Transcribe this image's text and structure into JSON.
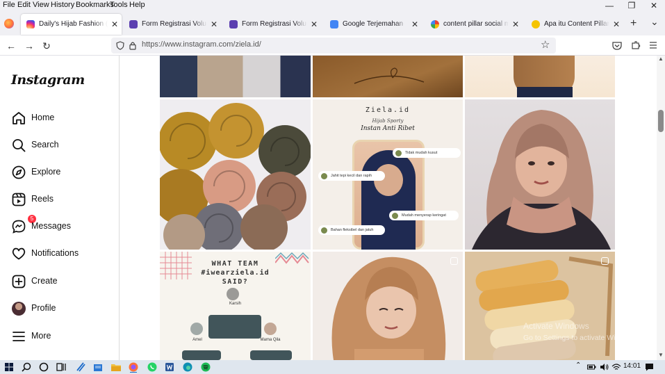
{
  "menubar": {
    "items": [
      "File",
      "Edit",
      "View",
      "History",
      "Bookmarks",
      "Tools",
      "Help"
    ],
    "minimize": "—",
    "restore": "❐",
    "close": "✕"
  },
  "tabs": [
    {
      "label": "Daily's Hijab Fashion (@ziela.id)",
      "favicon_color": "#d62976"
    },
    {
      "label": "Form Registrasi Volunteer Jalan",
      "favicon_color": "#5b3fb0"
    },
    {
      "label": "Form Registrasi Volunteer Jalan",
      "favicon_color": "#5b3fb0"
    },
    {
      "label": "Google Terjemahan",
      "favicon_color": "#4285f4"
    },
    {
      "label": "content pillar social media - Google",
      "favicon_color": "#ea4335"
    },
    {
      "label": "Apa itu Content Pillar? Pengertian",
      "favicon_color": "#f5c400"
    }
  ],
  "tab_close": "✕",
  "new_tab": "+",
  "tab_list": "⌄",
  "navbar": {
    "back": "←",
    "forward": "→",
    "reload": "↻",
    "url": "https://www.instagram.com/ziela.id/",
    "bookmark": "☆"
  },
  "instagram": {
    "logo": "Instagram",
    "nav": [
      {
        "label": "Home",
        "icon": "home-icon"
      },
      {
        "label": "Search",
        "icon": "search-icon"
      },
      {
        "label": "Explore",
        "icon": "explore-icon"
      },
      {
        "label": "Reels",
        "icon": "reels-icon"
      },
      {
        "label": "Messages",
        "icon": "messages-icon",
        "badge": "5"
      },
      {
        "label": "Notifications",
        "icon": "heart-icon"
      },
      {
        "label": "Create",
        "icon": "create-icon"
      },
      {
        "label": "Profile",
        "icon": "profile-avatar"
      },
      {
        "label": "More",
        "icon": "menu-icon"
      }
    ]
  },
  "posts": {
    "ad_brand": "Ziela.id",
    "ad_subtitle": "Hijab Sporty",
    "ad_title": "Instan Anti Ribet",
    "ad_bullets": [
      "Tidak mudah kusut",
      "Jahit tepi kecil dan rapih",
      "Mudah menyerap keringat",
      "Bahan fleksibel dan jatuh"
    ],
    "team_title_1": "WHAT TEAM",
    "team_title_2": "#iwearziela.id",
    "team_title_3": "SAID?",
    "team_names": [
      "Karsih",
      "Amel",
      "Mama Qila"
    ]
  },
  "watermark": {
    "line1": "Activate Windows",
    "line2": "Go to Settings to activate Windows."
  },
  "taskbar": {
    "clock": "14:01"
  }
}
